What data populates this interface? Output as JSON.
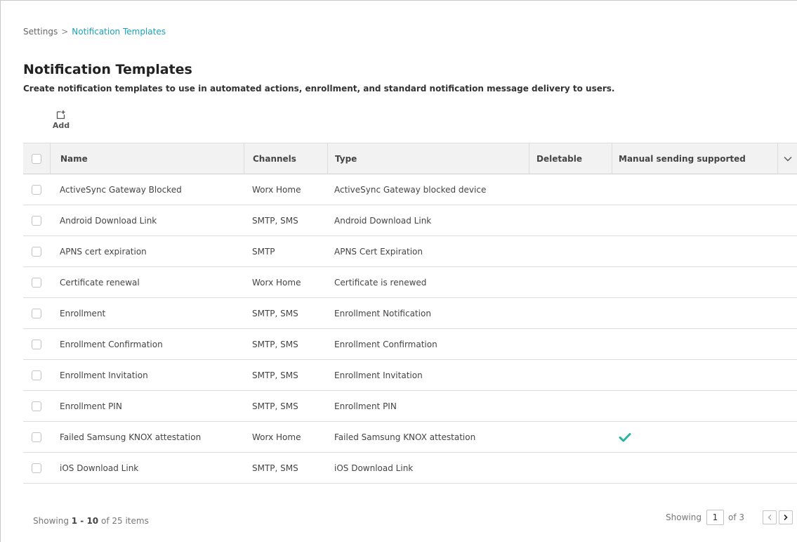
{
  "breadcrumb": {
    "parent": "Settings",
    "separator": ">",
    "current": "Notification Templates"
  },
  "page": {
    "title": "Notification Templates",
    "subtitle": "Create notification templates to use in automated actions, enrollment, and standard notification message delivery to users."
  },
  "toolbar": {
    "add_label": "Add",
    "add_icon": "add-document-icon"
  },
  "table": {
    "columns": {
      "name": "Name",
      "channels": "Channels",
      "type": "Type",
      "deletable": "Deletable",
      "manual": "Manual sending supported"
    },
    "rows": [
      {
        "name": "ActiveSync Gateway Blocked",
        "channels": "Worx Home",
        "type": "ActiveSync Gateway blocked device",
        "deletable": "",
        "manual": false
      },
      {
        "name": "Android Download Link",
        "channels": "SMTP, SMS",
        "type": "Android Download Link",
        "deletable": "",
        "manual": false
      },
      {
        "name": "APNS cert expiration",
        "channels": "SMTP",
        "type": "APNS Cert Expiration",
        "deletable": "",
        "manual": false
      },
      {
        "name": "Certificate renewal",
        "channels": "Worx Home",
        "type": "Certificate is renewed",
        "deletable": "",
        "manual": false
      },
      {
        "name": "Enrollment",
        "channels": "SMTP, SMS",
        "type": "Enrollment Notification",
        "deletable": "",
        "manual": false
      },
      {
        "name": "Enrollment Confirmation",
        "channels": "SMTP, SMS",
        "type": "Enrollment Confirmation",
        "deletable": "",
        "manual": false
      },
      {
        "name": "Enrollment Invitation",
        "channels": "SMTP, SMS",
        "type": "Enrollment Invitation",
        "deletable": "",
        "manual": false
      },
      {
        "name": "Enrollment PIN",
        "channels": "SMTP, SMS",
        "type": "Enrollment PIN",
        "deletable": "",
        "manual": false
      },
      {
        "name": "Failed Samsung KNOX attestation",
        "channels": "Worx Home",
        "type": "Failed Samsung KNOX attestation",
        "deletable": "",
        "manual": true
      },
      {
        "name": "iOS Download Link",
        "channels": "SMTP, SMS",
        "type": "iOS Download Link",
        "deletable": "",
        "manual": false
      }
    ]
  },
  "footer": {
    "showing_prefix": "Showing",
    "range": "1 - 10",
    "of_word": "of",
    "total_items": "25 items",
    "pager_label": "Showing",
    "current_page": "1",
    "of_pages": "of 3"
  },
  "colors": {
    "accent": "#1aa3b8",
    "check": "#2bb5a0"
  }
}
